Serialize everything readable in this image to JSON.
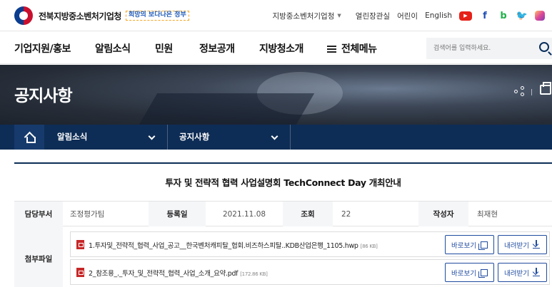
{
  "header": {
    "org_name": "전북지방중소벤처기업청",
    "slogan": "희망의 보다나은 정부",
    "util": {
      "site_dropdown": "지방중소벤처기업청",
      "links": [
        "열린장관실",
        "어린이",
        "English"
      ]
    },
    "sns": [
      "youtube-icon",
      "facebook-icon",
      "blog-icon",
      "twitter-icon",
      "instagram-icon"
    ]
  },
  "gnb": {
    "items": [
      "기업지원/홍보",
      "알림소식",
      "민원",
      "정보공개",
      "지방청소개"
    ],
    "all_menu": "전체메뉴",
    "search_placeholder": "검색어를 입력하세요."
  },
  "banner": {
    "title": "공지사항"
  },
  "location": {
    "depth1": "알림소식",
    "depth2": "공지사항"
  },
  "article": {
    "title": "투자 및 전략적 협력 사업설명회 TechConnect Day 개최안내",
    "info": {
      "dept_label": "담당부서",
      "dept": "조정평가팀",
      "date_label": "등록일",
      "date": "2021.11.08",
      "views_label": "조회",
      "views": "22",
      "author_label": "작성자",
      "author": "최재현"
    },
    "attach_label": "첨부파일",
    "files": [
      {
        "name": "1.투자및_전략적_협력_사업_공고__한국벤처캐피탈_협회.비즈하스피탈..KDB산업은행_1105.hwp",
        "size": "[86 KB]"
      },
      {
        "name": "2_참조용_._투자_및_전략적_협력_사업_소개_요약.pdf",
        "size": "[172.86 KB]"
      }
    ],
    "view_label": "바로보기",
    "download_label": "내려받기"
  }
}
